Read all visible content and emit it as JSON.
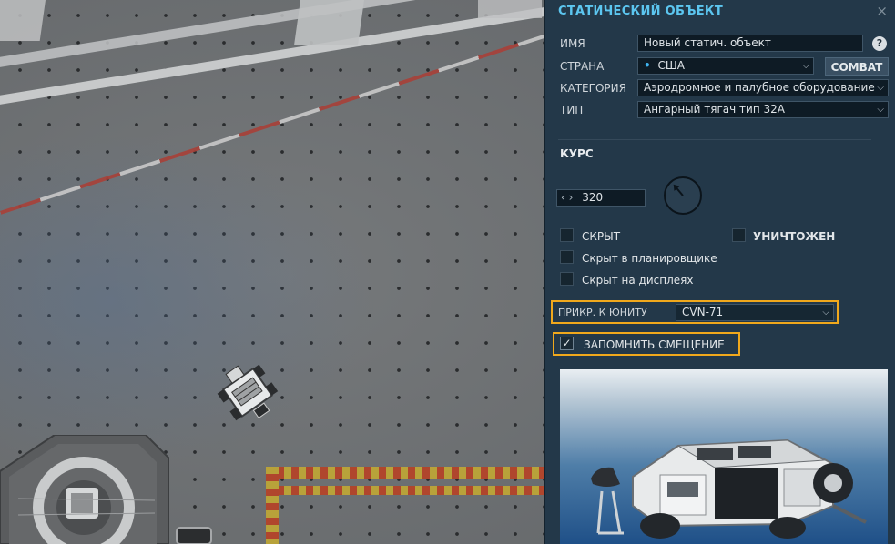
{
  "panel": {
    "title": "СТАТИЧЕСКИЙ ОБЪЕКТ",
    "close_glyph": "×",
    "help_glyph": "?",
    "name_label": "ИМЯ",
    "name_value": "Новый статич. объект",
    "country_label": "СТРАНА",
    "country_value": "США",
    "country_bullet": "•",
    "coalition_button": "COMBAT",
    "category_label": "КАТЕГОРИЯ",
    "category_value": "Аэродромное и палубное оборудование",
    "type_label": "ТИП",
    "type_value": "Ангарный тягач тип 32А",
    "heading_section": "КУРС",
    "heading_arrows": "‹ ›",
    "heading_value": "320",
    "heading_degrees": 320,
    "hidden_label": "СКРЫТ",
    "hidden_checked": false,
    "destroyed_label": "УНИЧТОЖЕН",
    "destroyed_checked": false,
    "hidden_planner_label": "Скрыт в планировщике",
    "hidden_planner_checked": false,
    "hidden_display_label": "Скрыт на дисплеях",
    "hidden_display_checked": false,
    "link_unit_label": "ПРИКР. К ЮНИТУ",
    "link_unit_value": "CVN-71",
    "offset_label": "ЗАПОМНИТЬ СМЕЩЕНИЕ",
    "offset_checked": true,
    "check_glyph": "✓",
    "dropdown_caret": "⌵"
  },
  "icons": {
    "close": "close-icon",
    "help": "help-icon",
    "caret": "chevron-down-icon",
    "check": "checkmark-icon",
    "compass": "heading-compass-icon"
  },
  "colors": {
    "panel_bg": "#233849",
    "title": "#5cc6f0",
    "highlight": "#f0a81c",
    "coalition_dot": "#3fb4f0"
  }
}
